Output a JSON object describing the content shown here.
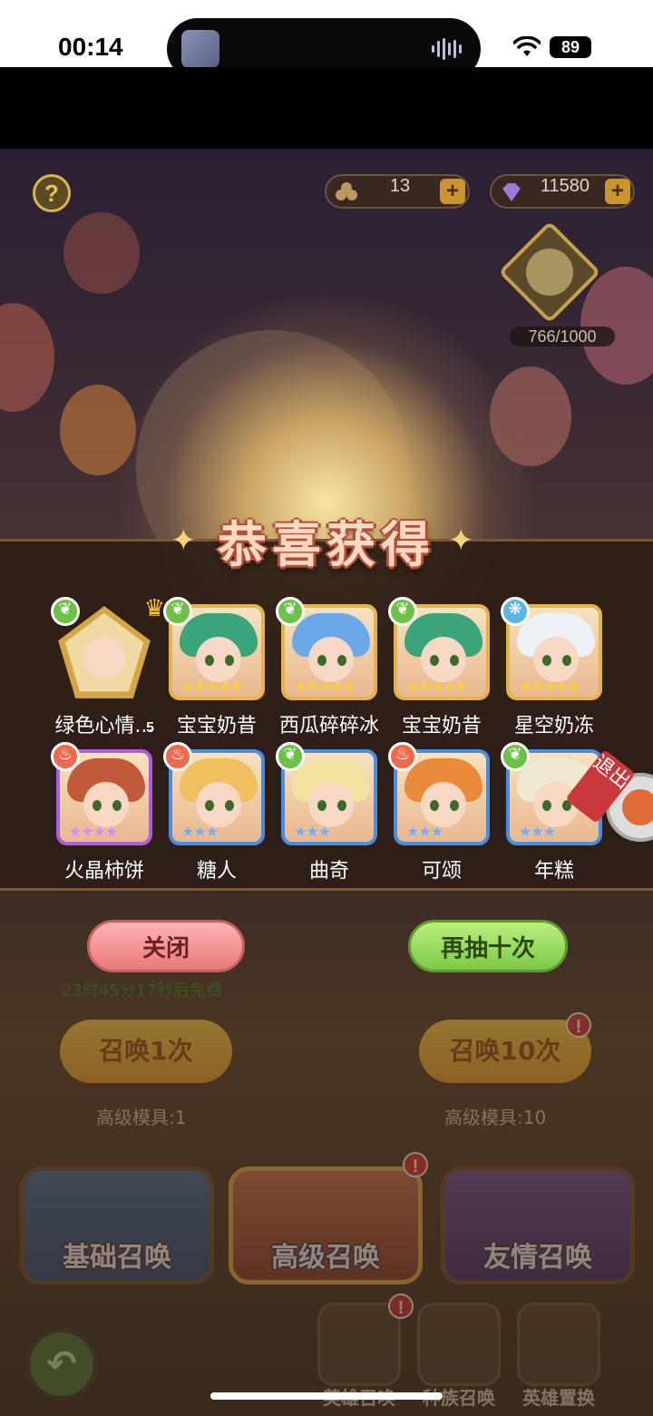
{
  "status_bar": {
    "time": "00:14",
    "battery": "89"
  },
  "resources": [
    {
      "icon": "mold-icon",
      "value": "13"
    },
    {
      "icon": "diamond-icon",
      "value": "11580"
    }
  ],
  "progress": {
    "text": "766/1000",
    "fraction": 0.766
  },
  "reward_panel": {
    "title": "恭喜获得",
    "items": [
      {
        "name": "绿色心情...",
        "element": "grass",
        "count": "5",
        "stars": 0
      },
      {
        "name": "宝宝奶昔",
        "element": "grass",
        "stars": 5
      },
      {
        "name": "西瓜碎碎冰",
        "element": "grass",
        "stars": 5
      },
      {
        "name": "宝宝奶昔",
        "element": "grass",
        "stars": 5
      },
      {
        "name": "星空奶冻",
        "element": "water",
        "stars": 5
      },
      {
        "name": "火晶柿饼",
        "element": "fire",
        "stars": 4
      },
      {
        "name": "糖人",
        "element": "fire",
        "stars": 3
      },
      {
        "name": "曲奇",
        "element": "grass",
        "stars": 3
      },
      {
        "name": "可颂",
        "element": "fire",
        "stars": 3
      },
      {
        "name": "年糕",
        "element": "grass",
        "stars": 3
      }
    ],
    "exit_tag": "退出"
  },
  "buttons": {
    "close": "关闭",
    "again": "再抽十次"
  },
  "free_note": "23时45分17秒后免费",
  "summon": {
    "once": "召唤1次",
    "ten": "召唤10次",
    "cost_once": "高级模具:1",
    "cost_ten": "高级模具:10"
  },
  "tabs": [
    "基础召唤",
    "高级召唤",
    "友情召唤"
  ],
  "bottom_nav": [
    "英雄召唤",
    "种族召唤",
    "英雄置换"
  ],
  "alert_mark": "!",
  "colors": {
    "accent_gold": "#e6b24a",
    "title_pink": "#ffd9c2",
    "close_red": "#e87a7a",
    "again_green": "#7ec84a"
  }
}
